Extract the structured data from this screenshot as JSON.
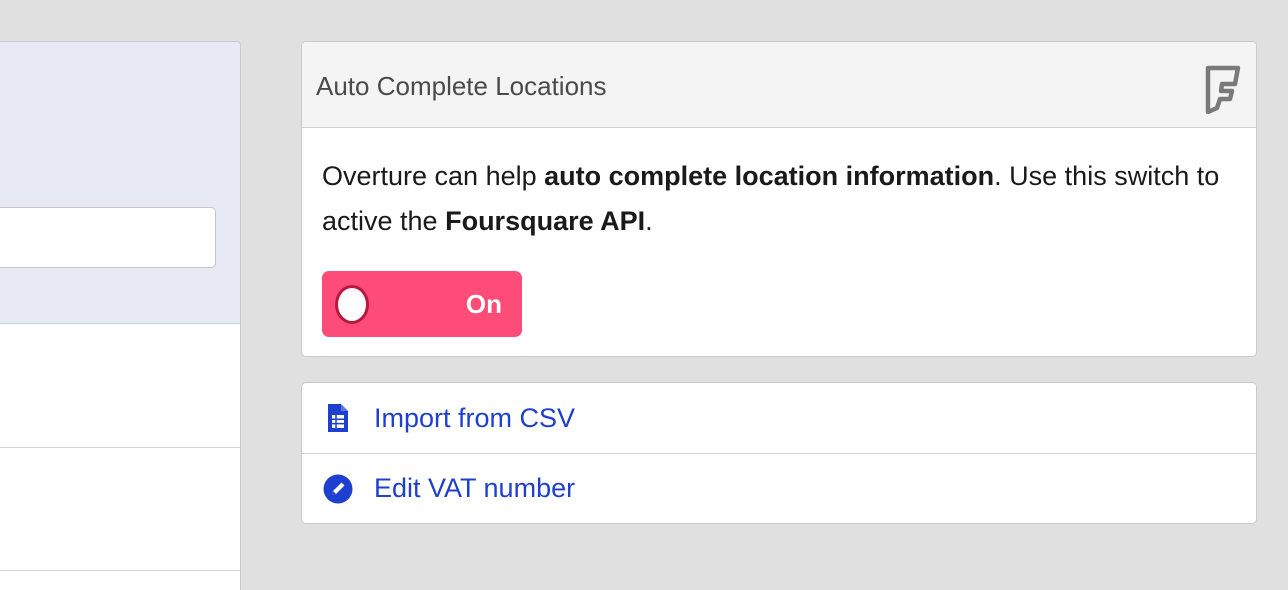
{
  "auto_complete": {
    "title": "Auto Complete Locations",
    "text_part1": "Overture can help ",
    "text_bold1": "auto complete location information",
    "text_part2": ". Use this switch to active the ",
    "text_bold2": "Foursquare API",
    "text_part3": ".",
    "toggle_label": "On",
    "toggle_color": "#fd4c78",
    "brand_icon": "foursquare-icon"
  },
  "actions": [
    {
      "label": "Import from CSV",
      "icon": "spreadsheet-icon"
    },
    {
      "label": "Edit VAT number",
      "icon": "pencil-icon"
    }
  ],
  "colors": {
    "background": "#e0e0e0",
    "link": "#1f3fcf",
    "left_header": "#e7eaf5"
  }
}
